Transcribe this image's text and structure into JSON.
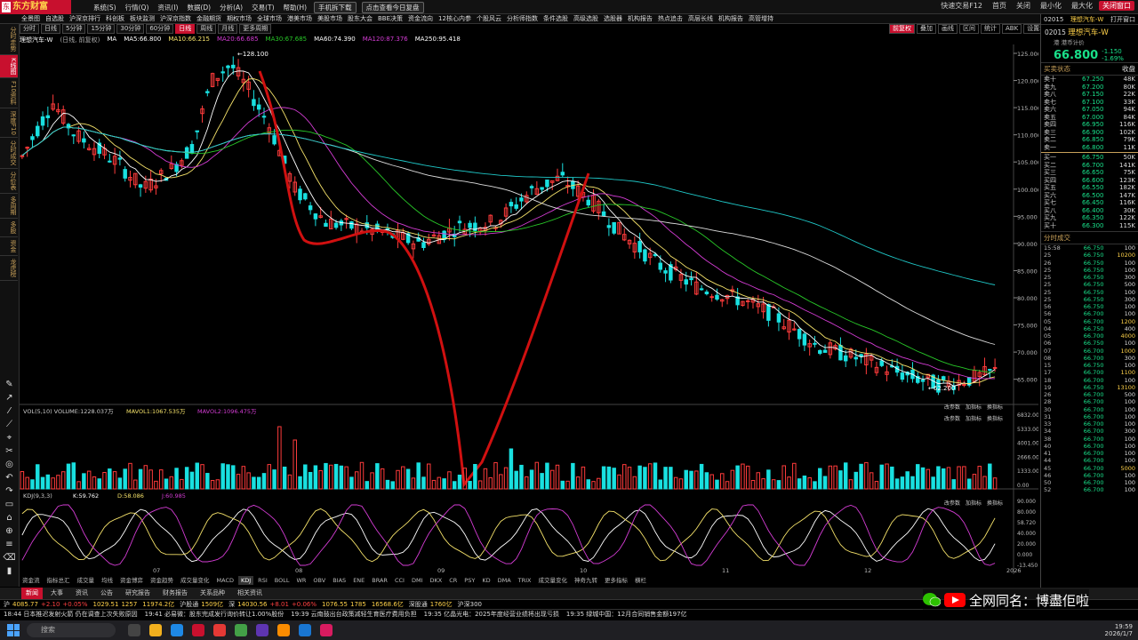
{
  "app": {
    "logo": "东方财富",
    "logo_badge": "东"
  },
  "menubar": {
    "items": [
      "系统(S)",
      "行情(Q)",
      "资讯(I)",
      "数据(D)",
      "分析(A)",
      "交易(T)",
      "帮助(H)"
    ],
    "buttons": [
      "手机拆下载",
      "点击查看今日复盘"
    ],
    "window": [
      "快速交易F12",
      "首页",
      "关闭",
      "最小化",
      "最大化",
      "关闭窗口"
    ]
  },
  "navbar": {
    "items": [
      "全景图",
      "自选股",
      "沪深京排行",
      "科创板",
      "板块监测",
      "沪深京指数",
      "金融期货",
      "期权市场",
      "全球市场",
      "港美市场",
      "美股市场",
      "股东大会",
      "BBE决策",
      "资金流向",
      "12核心内参",
      "个股风云",
      "分析师指数",
      "条件选股",
      "高级选股",
      "选股器",
      "机构报告",
      "热点追击",
      "高层长线",
      "机构报告",
      "高管增持"
    ]
  },
  "leftbar": {
    "items": [
      "分时走势",
      "K线图",
      "F10资料",
      "深度F10",
      "分时成交",
      "分价表",
      "多周期",
      "多股",
      "资金",
      "龙虎榜"
    ],
    "active_index": 1
  },
  "tools": {
    "items": [
      "✎",
      "↗",
      "⁄",
      "⟋",
      "⌖",
      "✂",
      "◎",
      "↶",
      "↷",
      "▭",
      "⌂",
      "⊕",
      "≡",
      "⌫",
      "▮"
    ]
  },
  "periods": {
    "items": [
      "分时",
      "日线",
      "5分钟",
      "15分钟",
      "30分钟",
      "60分钟",
      "日线",
      "周线",
      "月线",
      "更多周期"
    ],
    "active_index": 6
  },
  "charttoolbar": {
    "items": [
      "前复权",
      "叠加",
      "画线",
      "区间",
      "统计",
      "ABK",
      "设置均线"
    ],
    "active_index": 0
  },
  "titleline": {
    "name": "理想汽车-W",
    "period": "(日线, 前复权)",
    "ma": "MA",
    "ma5": "MA5:66.800",
    "ma10": "MA10:66.215",
    "ma20": "MA20:66.685",
    "ma30": "MA30:67.685",
    "ma60": "MA60:74.390",
    "ma120": "MA120:87.376",
    "ma250": "MA250:95.418"
  },
  "chart_data": {
    "type": "candlestick",
    "title": "理想汽车-W",
    "ylim": [
      62,
      125
    ],
    "yticks": [
      125,
      120,
      115,
      110,
      105,
      100,
      95,
      90,
      85,
      80,
      75,
      70,
      65
    ],
    "annotations": [
      {
        "text": "←128.100"
      },
      {
        "text": "←62.200"
      }
    ],
    "month_labels": [
      "07",
      "08",
      "09",
      "10",
      "11",
      "12",
      "2026"
    ],
    "volume": {
      "label": "VOL(5,10)",
      "vol": "VOLUME:1228.037万",
      "ma5": "MAVOL1:1067.535万",
      "ma10": "MAVOL2:1096.475万",
      "yticks": [
        "6832.00",
        "5333.00",
        "4001.00",
        "2666.00",
        "1333.00",
        "0.00"
      ],
      "unit": "万"
    },
    "kdj": {
      "label": "KDJ(9,3,3)",
      "k": "K:59.762",
      "d": "D:58.086",
      "j": "J:60.985",
      "yticks": [
        "90.000",
        "80.000",
        "58.720",
        "40.000",
        "20.000",
        "0.000",
        "-13.450"
      ]
    },
    "panel_buttons": [
      "改参数",
      "加指标",
      "换指标"
    ],
    "bottom_tabs": [
      "资金流",
      "指标总汇",
      "成交量",
      "均线",
      "资金博弈",
      "资金趋势",
      "成交量变化",
      "MACD",
      "KDJ",
      "RSI",
      "BOLL",
      "WR",
      "OBV",
      "BIAS",
      "ENE",
      "BRAR",
      "CCI",
      "DMI",
      "DKX",
      "CR",
      "PSY",
      "KD",
      "DMA",
      "TRIX",
      "成交量变化",
      "神奇九转",
      "更多指标",
      "横栏"
    ],
    "active_tab_index": 8
  },
  "rightpanel": {
    "header": [
      "02015",
      "理想汽车-W",
      "打开窗口"
    ],
    "code": "02015",
    "name": "理想汽车-W",
    "exchange_note": "港 港币计价",
    "price": "66.800",
    "change": "-1.150",
    "change_pct": "-1.69%",
    "orderbook_title": "买卖状态",
    "orderbook_mode": "收盘",
    "asks": [
      [
        "卖十",
        "67.250",
        "48K"
      ],
      [
        "卖九",
        "67.200",
        "80K"
      ],
      [
        "卖八",
        "67.150",
        "22K"
      ],
      [
        "卖七",
        "67.100",
        "33K"
      ],
      [
        "卖六",
        "67.050",
        "94K"
      ],
      [
        "卖五",
        "67.000",
        "84K"
      ],
      [
        "卖四",
        "66.950",
        "116K"
      ],
      [
        "卖三",
        "66.900",
        "102K"
      ],
      [
        "卖二",
        "66.850",
        "79K"
      ],
      [
        "卖一",
        "66.800",
        "11K"
      ]
    ],
    "bids": [
      [
        "买一",
        "66.750",
        "50K"
      ],
      [
        "买二",
        "66.700",
        "141K"
      ],
      [
        "买三",
        "66.650",
        "75K"
      ],
      [
        "买四",
        "66.600",
        "123K"
      ],
      [
        "买五",
        "66.550",
        "182K"
      ],
      [
        "买六",
        "66.500",
        "147K"
      ],
      [
        "买七",
        "66.450",
        "116K"
      ],
      [
        "买八",
        "66.400",
        "30K"
      ],
      [
        "买九",
        "66.350",
        "122K"
      ],
      [
        "买十",
        "66.300",
        "115K"
      ]
    ],
    "trades_title": "分时成交",
    "trades": [
      [
        "15:58",
        "66.750",
        "100"
      ],
      [
        "25",
        "66.750",
        "10200"
      ],
      [
        "26",
        "66.750",
        "100"
      ],
      [
        "25",
        "66.750",
        "100"
      ],
      [
        "25",
        "66.750",
        "300"
      ],
      [
        "25",
        "66.750",
        "500"
      ],
      [
        "25",
        "66.750",
        "100"
      ],
      [
        "25",
        "66.750",
        "300"
      ],
      [
        "56",
        "66.750",
        "100"
      ],
      [
        "56",
        "66.700",
        "100"
      ],
      [
        "05",
        "66.700",
        "1200"
      ],
      [
        "04",
        "66.750",
        "400"
      ],
      [
        "05",
        "66.700",
        "4000"
      ],
      [
        "06",
        "66.750",
        "100"
      ],
      [
        "07",
        "66.700",
        "1000"
      ],
      [
        "08",
        "66.700",
        "300"
      ],
      [
        "15",
        "66.750",
        "100"
      ],
      [
        "17",
        "66.700",
        "1100"
      ],
      [
        "18",
        "66.700",
        "100"
      ],
      [
        "19",
        "66.750",
        "13100"
      ],
      [
        "26",
        "66.700",
        "500"
      ],
      [
        "28",
        "66.700",
        "100"
      ],
      [
        "30",
        "66.700",
        "100"
      ],
      [
        "31",
        "66.700",
        "100"
      ],
      [
        "33",
        "66.700",
        "100"
      ],
      [
        "34",
        "66.700",
        "300"
      ],
      [
        "38",
        "66.700",
        "100"
      ],
      [
        "40",
        "66.700",
        "100"
      ],
      [
        "41",
        "66.700",
        "100"
      ],
      [
        "44",
        "66.700",
        "100"
      ],
      [
        "45",
        "66.700",
        "5000"
      ],
      [
        "46",
        "66.700",
        "100"
      ],
      [
        "50",
        "66.700",
        "100"
      ],
      [
        "52",
        "66.700",
        "100"
      ]
    ]
  },
  "sectabs": {
    "items": [
      "新闻",
      "大事",
      "资讯",
      "公告",
      "研究报告",
      "财务报告",
      "关系品种",
      "相关资讯"
    ],
    "active_index": 0
  },
  "ticker": [
    [
      "沪",
      "4085.77",
      "+2.10",
      "+0.05%"
    ],
    [
      "",
      "1029.51",
      "1257",
      ""
    ],
    [
      "",
      "11974.2亿",
      "",
      " "
    ],
    [
      "沪股通",
      "1509亿",
      "",
      ""
    ],
    [
      "深",
      "14030.56",
      "+8.01",
      "+0.06%"
    ],
    [
      "",
      "1076.55",
      "1785",
      ""
    ],
    [
      "",
      "16568.6亿",
      "",
      ""
    ],
    [
      "深股通",
      "1760亿",
      "",
      ""
    ],
    [
      "沪深300",
      "",
      "",
      ""
    ]
  ],
  "news": [
    "18:44 日本推迟发射火箭 仍在调查上次失败原因",
    "19:41 必易微：股东完成发行询价转让1.00%股份",
    "19:39 云南鼓出台政策减轻生育医疗费用负担",
    "19:35 亿晶光电：2025年度经营业绩将出现亏损",
    "19:35 绿城中国：12月合同销售金额197亿"
  ],
  "taskbar": {
    "search": "搜索",
    "time": "19:59",
    "date": "2026/1/7"
  },
  "watermark": {
    "text": "全网同名：博盡佢啦"
  }
}
